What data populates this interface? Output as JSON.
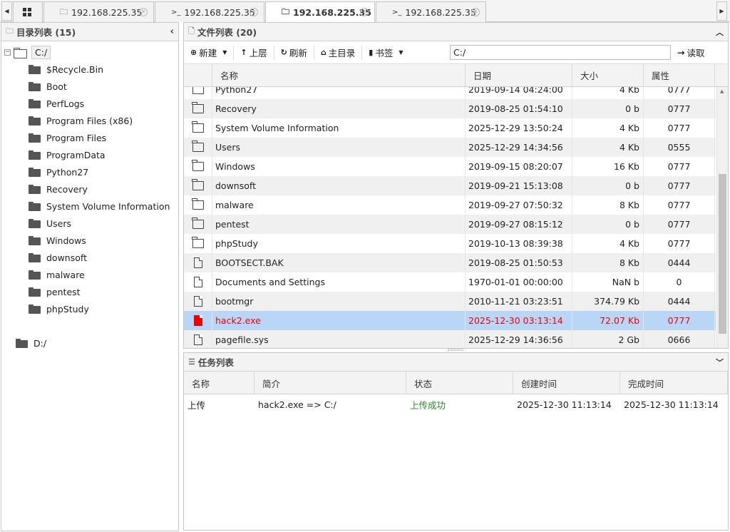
{
  "tabs": [
    {
      "label": "192.168.225.35",
      "icon": "folder-icon"
    },
    {
      "label": "192.168.225.35",
      "icon": "terminal-icon"
    },
    {
      "label": "192.168.225.35",
      "icon": "folder-icon",
      "active": true
    },
    {
      "label": "192.168.225.35",
      "icon": "terminal-icon"
    }
  ],
  "dir_panel": {
    "title": "目录列表 (15)",
    "root": "C:/",
    "items": [
      "$Recycle.Bin",
      "Boot",
      "PerfLogs",
      "Program Files (x86)",
      "Program Files",
      "ProgramData",
      "Python27",
      "Recovery",
      "System Volume Information",
      "Users",
      "Windows",
      "downsoft",
      "malware",
      "pentest",
      "phpStudy"
    ],
    "other_drive": "D:/"
  },
  "file_panel": {
    "title": "文件列表 (20)",
    "toolbar": {
      "new": "新建",
      "up": "上层",
      "refresh": "刷新",
      "home": "主目录",
      "bookmark": "书签",
      "path": "C:/",
      "read": "读取"
    },
    "columns": {
      "name": "名称",
      "date": "日期",
      "size": "大小",
      "attr": "属性"
    },
    "rows": [
      {
        "type": "folder",
        "name": "Python27",
        "date": "2019-09-14 04:24:00",
        "size": "4 Kb",
        "attr": "0777"
      },
      {
        "type": "folder",
        "name": "Recovery",
        "date": "2019-08-25 01:54:10",
        "size": "0 b",
        "attr": "0777"
      },
      {
        "type": "folder",
        "name": "System Volume Information",
        "date": "2025-12-29 13:50:24",
        "size": "4 Kb",
        "attr": "0777"
      },
      {
        "type": "folder",
        "name": "Users",
        "date": "2025-12-29 14:34:56",
        "size": "4 Kb",
        "attr": "0555"
      },
      {
        "type": "folder",
        "name": "Windows",
        "date": "2019-09-15 08:20:07",
        "size": "16 Kb",
        "attr": "0777"
      },
      {
        "type": "folder",
        "name": "downsoft",
        "date": "2019-09-21 15:13:08",
        "size": "0 b",
        "attr": "0777"
      },
      {
        "type": "folder",
        "name": "malware",
        "date": "2019-09-27 07:50:32",
        "size": "8 Kb",
        "attr": "0777"
      },
      {
        "type": "folder",
        "name": "pentest",
        "date": "2019-09-27 08:15:12",
        "size": "0 b",
        "attr": "0777"
      },
      {
        "type": "folder",
        "name": "phpStudy",
        "date": "2019-10-13 08:39:38",
        "size": "4 Kb",
        "attr": "0777"
      },
      {
        "type": "file",
        "name": "BOOTSECT.BAK",
        "date": "2019-08-25 01:50:53",
        "size": "8 Kb",
        "attr": "0444"
      },
      {
        "type": "file",
        "name": "Documents and Settings",
        "date": "1970-01-01 00:00:00",
        "size": "NaN b",
        "attr": "0"
      },
      {
        "type": "file",
        "name": "bootmgr",
        "date": "2010-11-21 03:23:51",
        "size": "374.79 Kb",
        "attr": "0444"
      },
      {
        "type": "exe",
        "name": "hack2.exe",
        "date": "2025-12-30 03:13:14",
        "size": "72.07 Kb",
        "attr": "0777",
        "selected": true
      },
      {
        "type": "file",
        "name": "pagefile.sys",
        "date": "2025-12-29 14:36:56",
        "size": "2 Gb",
        "attr": "0666"
      }
    ]
  },
  "task_panel": {
    "title": "任务列表",
    "columns": {
      "name": "名称",
      "desc": "简介",
      "status": "状态",
      "created": "创建时间",
      "finished": "完成时间"
    },
    "rows": [
      {
        "name": "上传",
        "desc": "hack2.exe => C:/",
        "status": "上传成功",
        "created": "2025-12-30 11:13:14",
        "finished": "2025-12-30 11:13:14"
      }
    ]
  },
  "colors": {
    "selected_row": "#b9d6f6",
    "selected_text": "#e00000",
    "success": "#2a8a2a"
  }
}
